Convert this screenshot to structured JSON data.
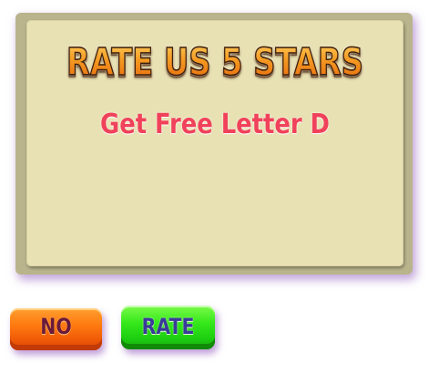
{
  "dialog": {
    "title": "RATE US 5 STARS",
    "subtitle": "Get Free Letter D"
  },
  "buttons": {
    "no_label": "NO",
    "rate_label": "RATE"
  },
  "colors": {
    "panel_border": "#b9b48c",
    "panel_fill": "#e8e1b4",
    "title_orange": "#f08b1a",
    "subtitle_red": "#f0425a",
    "no_button": "#ff7a10",
    "rate_button": "#34e81a",
    "shadow_purple": "#9660be"
  }
}
